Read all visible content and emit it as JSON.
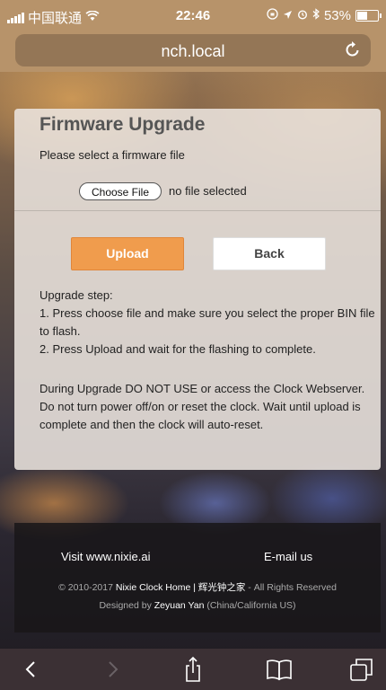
{
  "status_bar": {
    "carrier": "中国联通",
    "time": "22:46",
    "battery_percent": "53%",
    "battery_level": 0.53,
    "icons": [
      "signal-icon",
      "wifi-icon",
      "orientation-lock-icon",
      "location-icon",
      "alarm-icon",
      "bluetooth-icon",
      "battery-icon"
    ]
  },
  "browser": {
    "url": "nch.local",
    "reload_icon": "reload-icon"
  },
  "card": {
    "title": "Firmware Upgrade",
    "prompt": "Please select a firmware file",
    "choose_file_label": "Choose File",
    "no_file_text": "no file selected",
    "upload_label": "Upload",
    "back_label": "Back",
    "steps_heading": "Upgrade step:",
    "step1": "1. Press choose file and make sure you select the proper BIN file to flash.",
    "step2": "2. Press Upload and wait for the flashing to complete.",
    "warning": "During Upgrade DO NOT USE or access the Clock Webserver. Do not turn power off/on or reset the clock. Wait until upload is complete and then the clock will auto-reset."
  },
  "footer": {
    "visit": "Visit www.nixie.ai",
    "email": "E-mail us",
    "copyright_prefix": "© 2010-2017",
    "copyright_link": "Nixie Clock Home | 辉光钟之家",
    "copyright_suffix": "- All Rights Reserved",
    "designed_prefix": "Designed by",
    "designer": "Zeyuan Yan",
    "designer_location": "(China/California US)"
  },
  "toolbar": {
    "items": [
      "back-icon",
      "forward-icon",
      "share-icon",
      "bookmarks-icon",
      "tabs-icon"
    ]
  }
}
